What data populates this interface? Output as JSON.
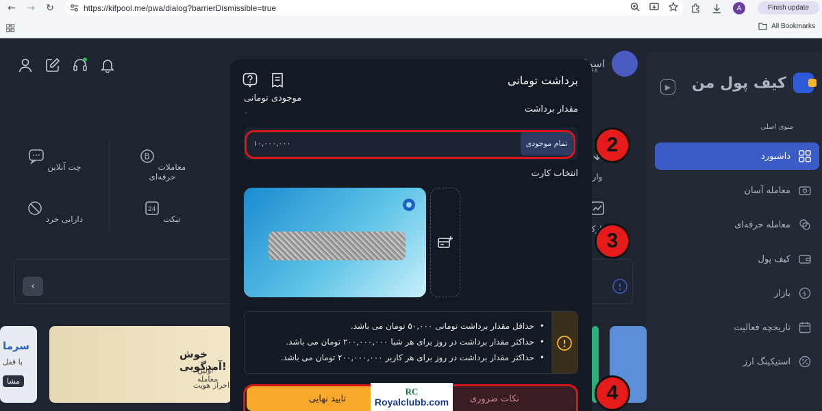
{
  "browser": {
    "url": "https://kifpool.me/pwa/dialog?barrierDismissible=true",
    "profile_initial": "A",
    "finish_update_label": "Finish update",
    "all_bookmarks_label": "All Bookmarks"
  },
  "sidebar": {
    "logo_text": "کیف پول من",
    "menu_title": "منوی اصلی",
    "items": [
      {
        "label": "داشبورد",
        "active": true
      },
      {
        "label": "معامله آسان",
        "active": false
      },
      {
        "label": "معامله حرفه‌ای",
        "active": false
      },
      {
        "label": "کیف پول",
        "active": false
      },
      {
        "label": "بازار",
        "active": false
      },
      {
        "label": "تاریخچه فعالیت",
        "active": false
      },
      {
        "label": "استیکینگ ارز",
        "active": false
      }
    ]
  },
  "header": {
    "user_name": "اسما حسینی نژاد",
    "user_sub": "۶۸"
  },
  "quick_actions": [
    {
      "label": "چت آنلاین"
    },
    {
      "label": "معاملات حرفه‌ای"
    },
    {
      "label": "دارایی خرد"
    },
    {
      "label": "تیکت"
    },
    {
      "label": "وار"
    },
    {
      "label": "مارک"
    }
  ],
  "banners": {
    "welcome_title": "خوش آمدگویی!",
    "welcome_line1": "اولین معامله",
    "welcome_line2": "احراز هویت",
    "left_title": "سرما",
    "left_sub": "با قفل",
    "left_btn": "مشا"
  },
  "modal": {
    "title": "برداشت تومانی",
    "balance_label": "موجودی تومانی",
    "balance_value": "۰",
    "amount_label": "مقدار برداشت",
    "amount_value": "۱۰,۰۰۰,۰۰۰",
    "max_button": "تمام موجودی",
    "card_label": "انتخاب کارت",
    "notices": [
      "حداقل مقدار برداشت تومانی ۵۰,۰۰۰ تومان می باشد.",
      "حداکثر مقدار برداشت در روز برای هر شبا ۲۰۰,۰۰۰,۰۰۰ تومان می باشد.",
      "حداکثر مقدار برداشت در روز برای هر کاربر ۲۰۰,۰۰۰,۰۰۰ تومان می باشد."
    ],
    "notes_button": "نکات ضروری",
    "confirm_button": "تایید نهایی"
  },
  "annotations": {
    "step2": "2",
    "step3": "3",
    "step4": "4"
  },
  "watermark": {
    "mark": "RC",
    "text": "Royalclubb.com"
  },
  "colors": {
    "accent": "#3b5bc7",
    "confirm": "#f7a92b",
    "annotation_red": "#e51b1b",
    "modal_bg": "#141a23",
    "page_bg": "#1e2430"
  }
}
